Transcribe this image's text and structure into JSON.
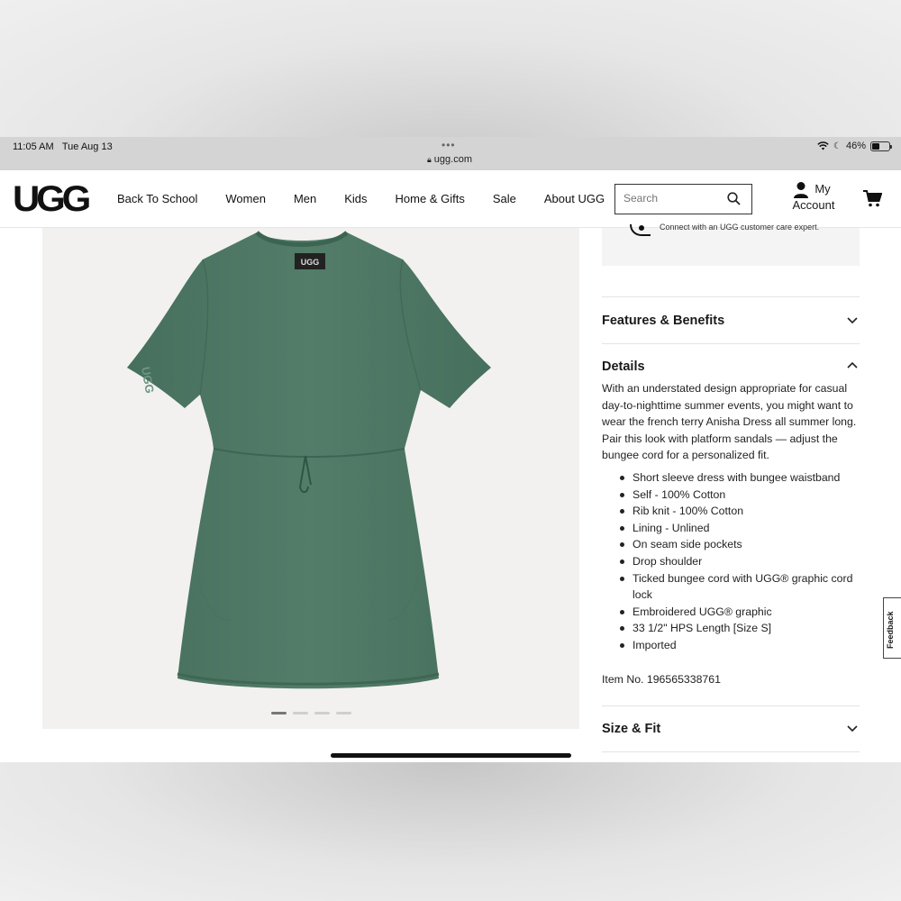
{
  "status_bar": {
    "time": "11:05 AM",
    "date": "Tue Aug 13",
    "url": "ugg.com",
    "battery": "46%",
    "battery_level": 0.46
  },
  "header": {
    "logo": "UGG",
    "nav": [
      "Back To School",
      "Women",
      "Men",
      "Kids",
      "Home & Gifts",
      "Sale",
      "About UGG"
    ],
    "search_placeholder": "Search",
    "account_line1": "My",
    "account_line2": "Account"
  },
  "product_image": {
    "label_on_dress": "UGG",
    "sleeve_logo": "UGG",
    "dress_color": "#4f7664",
    "slide_count": 4,
    "active_slide": 1
  },
  "care_box": {
    "text": "Connect with an UGG customer care expert."
  },
  "accordions": {
    "features": "Features & Benefits",
    "details": "Details",
    "size_fit": "Size & Fit"
  },
  "details": {
    "description": "With an understated design appropriate for casual day-to-nighttime summer events, you might want to wear the french terry Anisha Dress all summer long. Pair this look with platform sandals — adjust the bungee cord for a personalized fit.",
    "bullets": [
      "Short sleeve dress with bungee waistband",
      "Self - 100% Cotton",
      "Rib knit - 100% Cotton",
      "Lining - Unlined",
      "On seam side pockets",
      "Drop shoulder",
      "Ticked bungee cord with UGG® graphic cord lock",
      "Embroidered UGG® graphic",
      "33 1/2\" HPS Length [Size S]",
      "Imported"
    ],
    "item_no": "Item No. 196565338761"
  },
  "feedback": "Feedback"
}
